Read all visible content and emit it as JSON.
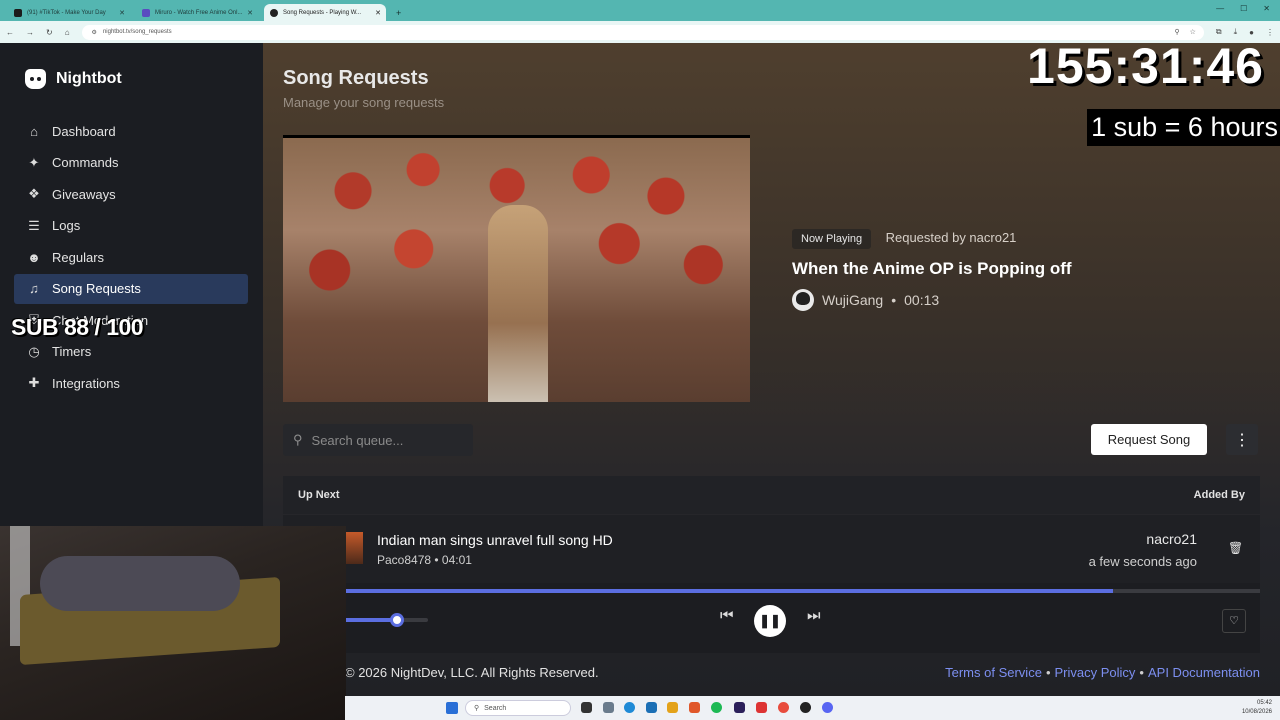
{
  "browser": {
    "tabs": [
      {
        "title": "(91) #TikTok - Make Your Day"
      },
      {
        "title": "Miruro - Watch Free Anime Onl..."
      },
      {
        "title": "Song Requests - Playing W..."
      }
    ],
    "url": "nightbot.tv/song_requests"
  },
  "sidebar": {
    "brand": "Nightbot",
    "items": [
      {
        "label": "Dashboard",
        "icon": "home-icon"
      },
      {
        "label": "Commands",
        "icon": "wand-icon"
      },
      {
        "label": "Giveaways",
        "icon": "gift-icon"
      },
      {
        "label": "Logs",
        "icon": "list-icon"
      },
      {
        "label": "Regulars",
        "icon": "users-icon"
      },
      {
        "label": "Song Requests",
        "icon": "headphones-icon",
        "active": true
      },
      {
        "label": "Chat Moderation",
        "icon": "shield-icon"
      },
      {
        "label": "Timers",
        "icon": "clock-icon"
      },
      {
        "label": "Integrations",
        "icon": "puzzle-icon"
      }
    ]
  },
  "overlays": {
    "sub_goal": "SUB 88 / 100",
    "timer": "155:31:46",
    "sub_rate": "1 sub = 6 hours"
  },
  "header": {
    "title": "Song Requests",
    "subtitle": "Manage your song requests"
  },
  "now_playing": {
    "badge": "Now Playing",
    "requested_by": "Requested by nacro21",
    "title": "When the Anime OP is Popping off",
    "channel": "WujiGang",
    "duration": "00:13"
  },
  "search": {
    "placeholder": "Search queue..."
  },
  "actions": {
    "request_song": "Request Song"
  },
  "queue": {
    "header_left": "Up Next",
    "header_right": "Added By",
    "items": [
      {
        "title": "Indian man sings unravel full song HD",
        "meta": "Paco8478 • 04:01",
        "added_by": "nacro21",
        "added_when": "a few seconds ago"
      }
    ]
  },
  "player": {
    "progress_fraction": 0.84,
    "volume_fraction": 0.64
  },
  "footer": {
    "copyright": "© 2026 NightDev, LLC. All Rights Reserved.",
    "links": [
      "Terms of Service",
      "Privacy Policy",
      "API Documentation"
    ]
  },
  "taskbar": {
    "search_placeholder": "Search",
    "time": "05:42",
    "date": "10/08/2026"
  },
  "colors": {
    "accent": "#5b6ee1",
    "link": "#7c8ff0",
    "active_nav": "#293a5c",
    "browser_frame": "#54b6b1"
  }
}
